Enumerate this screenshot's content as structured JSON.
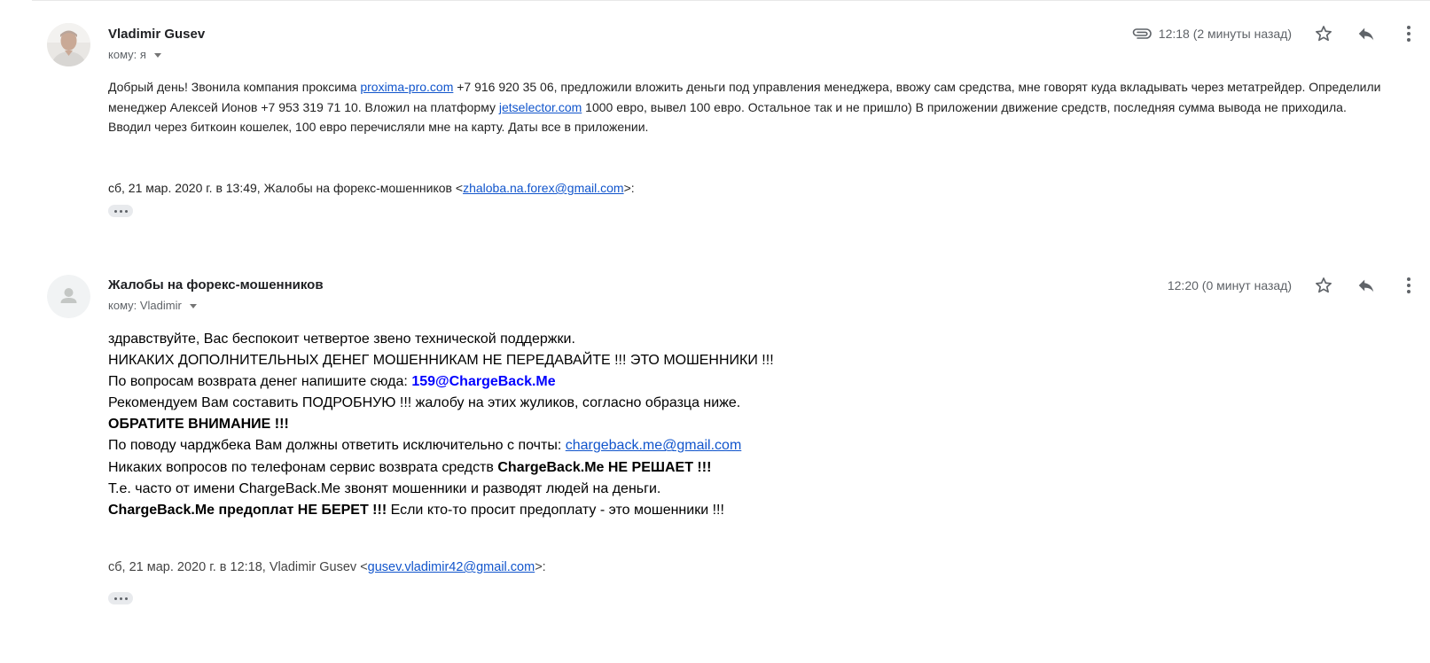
{
  "messages": [
    {
      "sender": "Vladimir Gusev",
      "recipient": "кому: я",
      "time": "12:18 (2 минуты назад)",
      "has_attachment": true,
      "body": {
        "p1_a": "Добрый день! Звонила компания проксима ",
        "p1_link1": "proxima-pro.com",
        "p1_b": " +7 916 920 35 06, предложили вложить деньги под управления менеджера, ввожу сам средства, мне говорят куда вкладывать через метатрейдер. Определили менеджер Алексей Ионов +7 953 319 71 10. Вложил на платформу ",
        "p1_link2": "jetselector.com",
        "p1_c": " 1000 евро, вывел 100 евро. Остальное так и не пришло) В приложении движение средств, последняя сумма вывода не приходила.",
        "p2": "Вводил через биткоин кошелек, 100 евро перечисляли мне на карту. Даты все в приложении."
      },
      "quote": {
        "prefix": "сб, 21 мар. 2020 г. в 13:49, Жалобы на форекс-мошенников <",
        "email": "zhaloba.na.forex@gmail.com",
        "suffix": ">:"
      }
    },
    {
      "sender": "Жалобы на форекс-мошенников",
      "recipient": "кому: Vladimir",
      "time": "12:20 (0 минут назад)",
      "has_attachment": false,
      "body": {
        "l1": "здравствуйте, Вас беспокоит четвертое звено технической поддержки.",
        "l2": "НИКАКИХ ДОПОЛНИТЕЛЬНЫХ ДЕНЕГ МОШЕННИКАМ НЕ ПЕРЕДАВАЙТЕ !!! ЭТО МОШЕННИКИ !!!",
        "l3_a": "По вопросам возврата денег напишите сюда: ",
        "l3_email": "159@ChargeBack.Me",
        "l4": "Рекомендуем Вам составить ПОДРОБНУЮ !!! жалобу на этих жуликов, согласно образца ниже.",
        "l5": "ОБРАТИТЕ ВНИМАНИЕ !!!",
        "l6_a": "По поводу чарджбека Вам должны ответить исключительно с почты: ",
        "l6_link": "chargeback.me@gmail.com",
        "l7_a": "Никаких вопросов по телефонам сервис возврата средств ",
        "l7_b": "ChargeBack.Me НЕ РЕШАЕТ !!!",
        "l8": "Т.е. часто от имени ChargeBack.Me звонят мошенники и разводят людей на деньги.",
        "l9_a": "ChargeBack.Me предоплат НЕ БЕРЕТ !!!",
        "l9_b": " Если кто-то просит предоплату - это мошенники !!!"
      },
      "quote": {
        "prefix": "сб, 21 мар. 2020 г. в 12:18, Vladimir Gusev <",
        "email": "gusev.vladimir42@gmail.com",
        "suffix": ">:"
      }
    }
  ],
  "icons": {
    "attachment": "paperclip-icon",
    "star": "star-icon",
    "reply": "reply-icon",
    "more": "more-vert-icon",
    "show_trimmed": "show-trimmed-content-icon"
  },
  "colors": {
    "link": "#1155cc",
    "highlight_email": "#0000ff",
    "secondary_text": "#5f6368"
  }
}
